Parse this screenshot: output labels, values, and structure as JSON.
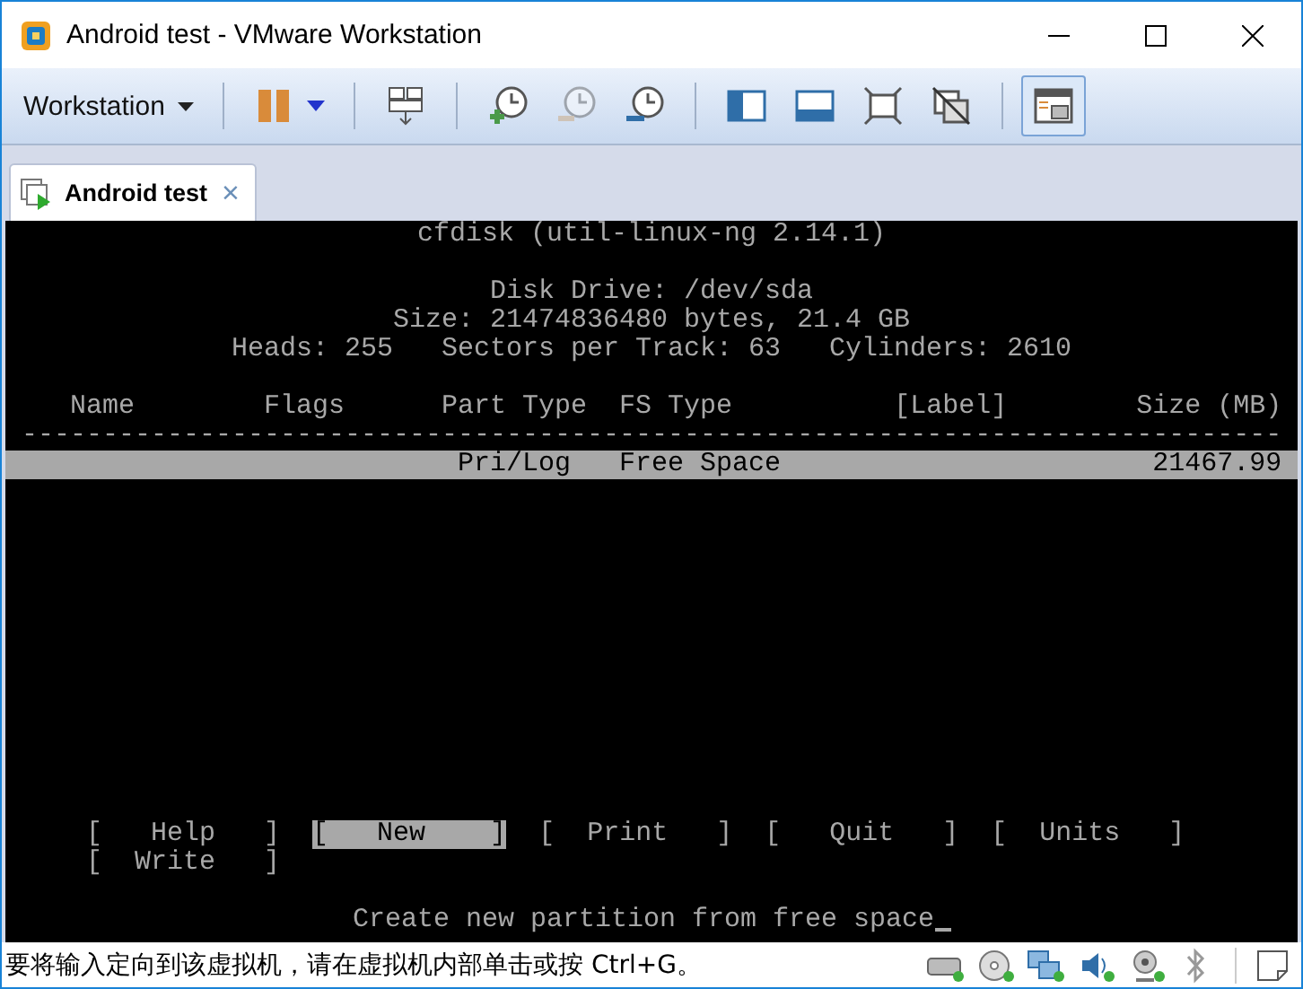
{
  "window": {
    "title": "Android test - VMware Workstation"
  },
  "toolbar": {
    "menu": "Workstation",
    "buttons": [
      {
        "kind": "pause",
        "disabled": false,
        "selected": false
      },
      {
        "kind": "send-keys",
        "disabled": false,
        "selected": false
      },
      {
        "kind": "snapshot-take",
        "disabled": false,
        "selected": false
      },
      {
        "kind": "snapshot-revert",
        "disabled": true,
        "selected": false
      },
      {
        "kind": "snapshot-manage",
        "disabled": false,
        "selected": false
      },
      {
        "kind": "library",
        "disabled": false,
        "selected": false
      },
      {
        "kind": "thumbnails",
        "disabled": false,
        "selected": false
      },
      {
        "kind": "fullscreen",
        "disabled": false,
        "selected": false
      },
      {
        "kind": "unity",
        "disabled": false,
        "selected": false
      },
      {
        "kind": "console-view",
        "disabled": false,
        "selected": true
      }
    ]
  },
  "tabs": [
    {
      "label": "Android test",
      "selected": true,
      "close": "×"
    }
  ],
  "console": {
    "title": "cfdisk (util-linux-ng 2.14.1)",
    "disk_drive": "Disk Drive: /dev/sda",
    "size": "Size: 21474836480 bytes, 21.4 GB",
    "geometry": "Heads: 255   Sectors per Track: 63   Cylinders: 2610",
    "columns": [
      "Name",
      "Flags",
      "Part Type",
      "FS Type",
      "[Label]",
      "Size (MB)"
    ],
    "separator": "------------------------------------------------------------------------------",
    "rows": [
      {
        "part_type": "Pri/Log",
        "fs_type": "Free Space",
        "size": "21467.99",
        "selected": true
      }
    ],
    "menu": [
      {
        "label": "[   Help   ]",
        "selected": false
      },
      {
        "label": "[   New    ]",
        "selected": true
      },
      {
        "label": "[  Print   ]",
        "selected": false
      },
      {
        "label": "[   Quit   ]",
        "selected": false
      },
      {
        "label": "[  Units   ]",
        "selected": false
      },
      {
        "label": "[  Write   ]",
        "selected": false
      }
    ],
    "message": "Create new partition from free space",
    "cursor": true
  },
  "status_bar": {
    "text": "要将输入定向到该虚拟机，请在虚拟机内部单击或按 Ctrl+G。",
    "devices": [
      {
        "kind": "disk"
      },
      {
        "kind": "cd"
      },
      {
        "kind": "network"
      },
      {
        "kind": "sound"
      },
      {
        "kind": "camera"
      },
      {
        "kind": "bluetooth"
      }
    ]
  }
}
